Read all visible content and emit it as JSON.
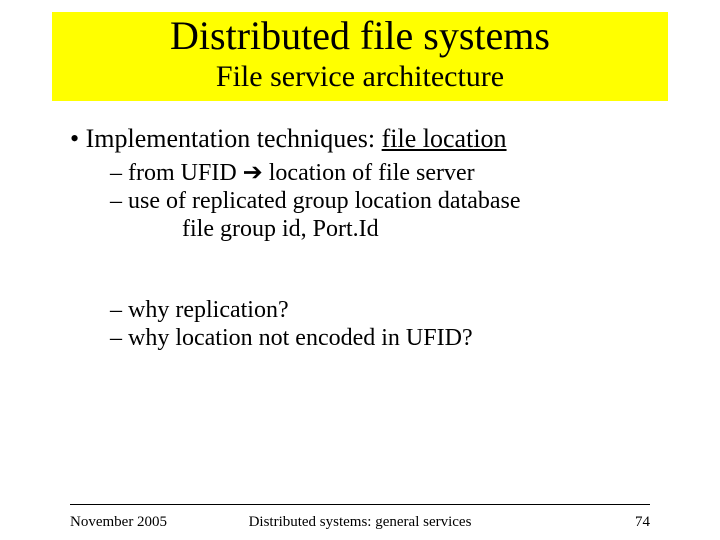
{
  "title": "Distributed file systems",
  "subtitle": "File service architecture",
  "bullet": {
    "prefix": "• ",
    "lead": "Implementation techniques: ",
    "underlined": "file location"
  },
  "sub": {
    "line1_a": "– from UFID  ",
    "line1_arrow": "➔",
    "line1_b": "  location of file server",
    "line2": "– use of replicated group location database",
    "line3": "file group id, Port.Id",
    "line4": "– why replication?",
    "line5": "– why location not encoded in UFID?"
  },
  "footer": {
    "date": "November 2005",
    "center": "Distributed systems: general services",
    "page": "74"
  }
}
